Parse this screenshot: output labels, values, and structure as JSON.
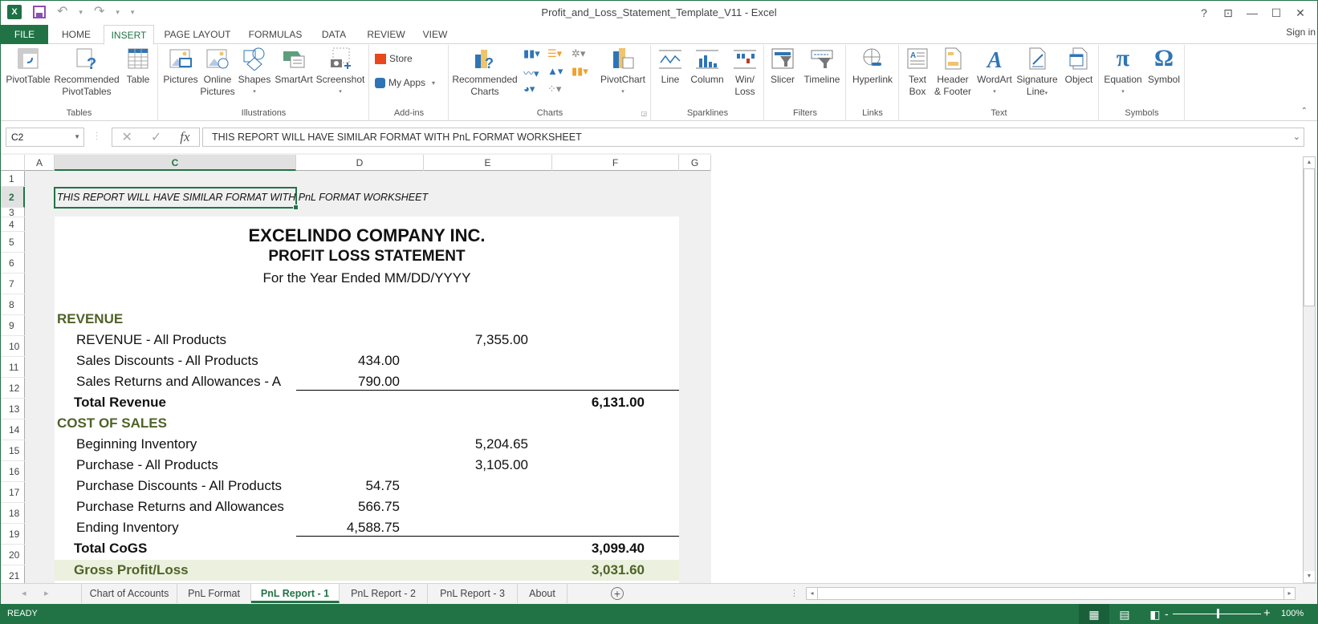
{
  "window": {
    "title": "Profit_and_Loss_Statement_Template_V11 - Excel",
    "app_icon": "excel-icon",
    "qat": {
      "save": "save-icon",
      "undo": "↶",
      "redo": "↷",
      "customize": "▾"
    },
    "controls": {
      "help": "?",
      "ribbon_display": "⊡",
      "minimize": "—",
      "maximize": "☐",
      "close": "✕"
    },
    "sign_in": "Sign in"
  },
  "ribbon_tabs": [
    {
      "label": "FILE"
    },
    {
      "label": "HOME"
    },
    {
      "label": "INSERT",
      "active": true
    },
    {
      "label": "PAGE LAYOUT"
    },
    {
      "label": "FORMULAS"
    },
    {
      "label": "DATA"
    },
    {
      "label": "REVIEW"
    },
    {
      "label": "VIEW"
    }
  ],
  "ribbon": {
    "groups": [
      {
        "label": "Tables",
        "buttons": [
          "PivotTable",
          "Recommended PivotTables",
          "Table"
        ]
      },
      {
        "label": "Illustrations",
        "buttons": [
          "Pictures",
          "Online Pictures",
          "Shapes",
          "SmartArt",
          "Screenshot"
        ]
      },
      {
        "label": "Add-ins",
        "buttons": [
          "Store",
          "My Apps"
        ]
      },
      {
        "label": "Charts",
        "buttons": [
          "Recommended Charts",
          "PivotChart"
        ]
      },
      {
        "label": "Sparklines",
        "buttons": [
          "Line",
          "Column",
          "Win/ Loss"
        ]
      },
      {
        "label": "Filters",
        "buttons": [
          "Slicer",
          "Timeline"
        ]
      },
      {
        "label": "Links",
        "buttons": [
          "Hyperlink"
        ]
      },
      {
        "label": "Text",
        "buttons": [
          "Text Box",
          "Header & Footer",
          "WordArt",
          "Signature Line",
          "Object"
        ]
      },
      {
        "label": "Symbols",
        "buttons": [
          "Equation",
          "Symbol"
        ]
      }
    ],
    "labels": {
      "pivottable": "PivotTable",
      "rec_pivot_1": "Recommended",
      "rec_pivot_2": "PivotTables",
      "table": "Table",
      "pictures": "Pictures",
      "online_1": "Online",
      "online_2": "Pictures",
      "shapes": "Shapes",
      "smartart": "SmartArt",
      "screenshot": "Screenshot",
      "store": "Store",
      "myapps": "My Apps",
      "rec_charts_1": "Recommended",
      "rec_charts_2": "Charts",
      "pivotchart": "PivotChart",
      "line": "Line",
      "column": "Column",
      "winloss_1": "Win/",
      "winloss_2": "Loss",
      "slicer": "Slicer",
      "timeline": "Timeline",
      "hyperlink": "Hyperlink",
      "textbox_1": "Text",
      "textbox_2": "Box",
      "header_1": "Header",
      "header_2": "& Footer",
      "wordart": "WordArt",
      "signature_1": "Signature",
      "signature_2": "Line",
      "object": "Object",
      "equation": "Equation",
      "symbol": "Symbol",
      "g_tables": "Tables",
      "g_illustrations": "Illustrations",
      "g_addins": "Add-ins",
      "g_charts": "Charts",
      "g_sparklines": "Sparklines",
      "g_filters": "Filters",
      "g_links": "Links",
      "g_text": "Text",
      "g_symbols": "Symbols"
    }
  },
  "formula_bar": {
    "name_box": "C2",
    "cancel": "✕",
    "enter": "✓",
    "fx": "fx",
    "formula": "THIS REPORT WILL HAVE SIMILAR FORMAT WITH PnL FORMAT WORKSHEET"
  },
  "columns": [
    "A",
    "C",
    "D",
    "E",
    "F",
    "G"
  ],
  "selected_column": "C",
  "rows": [
    "1",
    "2",
    "3",
    "4",
    "5",
    "6",
    "7",
    "8",
    "9",
    "10",
    "11",
    "12",
    "13",
    "14",
    "15",
    "16",
    "17",
    "18",
    "19",
    "20",
    "21"
  ],
  "selected_row": "2",
  "sheet": {
    "note": "THIS REPORT WILL HAVE SIMILAR FORMAT WITH PnL FORMAT WORKSHEET",
    "company": "EXCELINDO COMPANY INC.",
    "statement": "PROFIT LOSS STATEMENT",
    "period": "For the Year Ended MM/DD/YYYY",
    "revenue": {
      "header": "REVENUE",
      "lines": [
        {
          "label": "REVENUE - All Products",
          "col_d": "",
          "col_e": "7,355.00"
        },
        {
          "label": "Sales Discounts - All Products",
          "col_d": "434.00",
          "col_e": ""
        },
        {
          "label": "Sales Returns and Allowances - A",
          "col_d": "790.00",
          "col_e": ""
        }
      ],
      "total_label": "Total Revenue",
      "total": "6,131.00"
    },
    "cost_of_sales": {
      "header": "COST OF SALES",
      "lines": [
        {
          "label": "Beginning Inventory",
          "col_d": "",
          "col_e": "5,204.65"
        },
        {
          "label": "Purchase - All Products",
          "col_d": "",
          "col_e": "3,105.00"
        },
        {
          "label": "Purchase Discounts - All Products",
          "col_d": "54.75",
          "col_e": ""
        },
        {
          "label": "Purchase Returns and Allowances",
          "col_d": "566.75",
          "col_e": ""
        },
        {
          "label": "Ending Inventory",
          "col_d": "4,588.75",
          "col_e": ""
        }
      ],
      "total_label": "Total CoGS",
      "total": "3,099.40"
    },
    "gross_profit_label": "Gross Profit/Loss",
    "gross_profit": "3,031.60"
  },
  "sheet_tabs": [
    {
      "label": "Chart of Accounts"
    },
    {
      "label": "PnL Format"
    },
    {
      "label": "PnL Report - 1",
      "active": true
    },
    {
      "label": "PnL Report - 2"
    },
    {
      "label": "PnL Report - 3"
    },
    {
      "label": "About"
    }
  ],
  "status_bar": {
    "mode": "READY",
    "zoom": "100%",
    "zoom_level_percent": 100
  },
  "colors": {
    "accent": "#217346",
    "section_text": "#4f6228",
    "gross_profit_fill": "#ebf1de"
  }
}
